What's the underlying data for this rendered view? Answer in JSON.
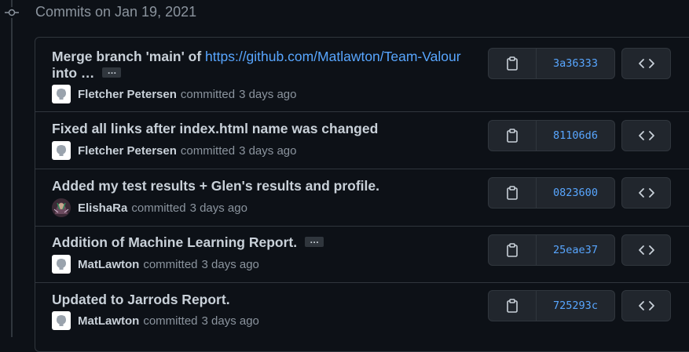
{
  "group": {
    "header": "Commits on Jan 19, 2021"
  },
  "commits": [
    {
      "title_prefix": "Merge branch 'main' of ",
      "title_link": "https://github.com/Matlawton/Team-Valour",
      "title_line2": "into …",
      "ellipsis": "…",
      "author": "Fletcher Petersen",
      "verb": "committed",
      "time": "3 days ago",
      "sha": "3a36333",
      "avatar": "github-default-avatar"
    },
    {
      "title": "Fixed all links after index.html name was changed",
      "author": "Fletcher Petersen",
      "verb": "committed",
      "time": "3 days ago",
      "sha": "81106d6",
      "avatar": "github-default-avatar"
    },
    {
      "title": "Added my test results + Glen's results and profile.",
      "author": "ElishaRa",
      "verb": "committed",
      "time": "3 days ago",
      "sha": "0823600",
      "avatar": "user-photo-avatar"
    },
    {
      "title": "Addition of Machine Learning Report.",
      "ellipsis": "…",
      "author": "MatLawton",
      "verb": "committed",
      "time": "3 days ago",
      "sha": "25eae37",
      "avatar": "github-default-avatar"
    },
    {
      "title": "Updated to Jarrods Report.",
      "author": "MatLawton",
      "verb": "committed",
      "time": "3 days ago",
      "sha": "725293c",
      "avatar": "github-default-avatar"
    }
  ],
  "colors": {
    "background": "#0d1117",
    "border": "#30363d",
    "button_bg": "#21262d",
    "text": "#c9d1d9",
    "muted": "#8b949e",
    "link": "#58a6ff"
  },
  "icons": {
    "timeline": "commit-node-icon",
    "copy": "clipboard-icon",
    "browse": "code-icon"
  }
}
